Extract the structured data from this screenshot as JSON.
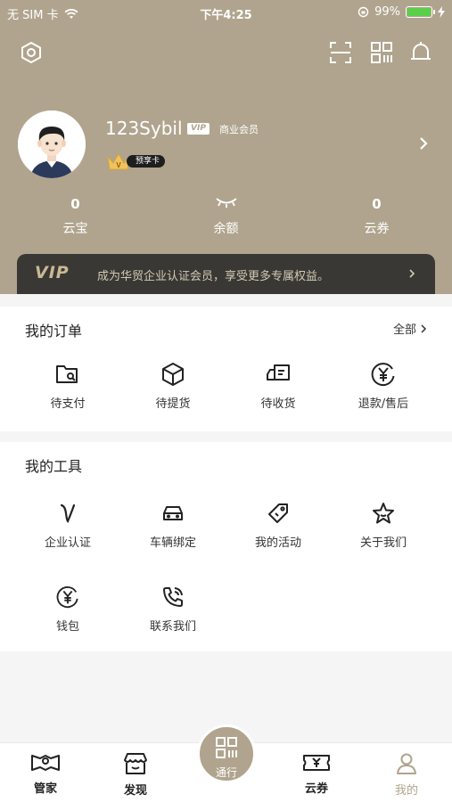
{
  "status_bar": {
    "carrier": "无 SIM 卡",
    "time": "下午4:25",
    "battery": "99%",
    "battery_level": 0.99
  },
  "header": {
    "settings_icon": "settings-hex-icon",
    "scan_icon": "scan-icon",
    "qrcode_icon": "qrcode-icon",
    "bell_icon": "bell-icon"
  },
  "profile": {
    "username": "123Sybil",
    "vip_tag": "VIP",
    "member_type": "商业会员",
    "badge": "预享卡"
  },
  "stats": [
    {
      "value": "0",
      "label": "云宝"
    },
    {
      "value": "",
      "label": "余额"
    },
    {
      "value": "0",
      "label": "云券"
    }
  ],
  "vip_banner": {
    "logo": "VIP",
    "text": "成为华贸企业认证会员，享受更多专属权益。"
  },
  "orders": {
    "title": "我的订单",
    "more": "全部",
    "items": [
      {
        "label": "待支付",
        "icon": "wallet-icon"
      },
      {
        "label": "待提货",
        "icon": "box-icon"
      },
      {
        "label": "待收货",
        "icon": "truck-icon"
      },
      {
        "label": "退款/售后",
        "icon": "yen-circle-icon"
      }
    ]
  },
  "tools": {
    "title": "我的工具",
    "items": [
      {
        "label": "企业认证",
        "icon": "v-icon"
      },
      {
        "label": "车辆绑定",
        "icon": "car-icon"
      },
      {
        "label": "我的活动",
        "icon": "tag-icon"
      },
      {
        "label": "关于我们",
        "icon": "star-icon"
      },
      {
        "label": "钱包",
        "icon": "yen-circle-icon"
      },
      {
        "label": "联系我们",
        "icon": "phone-icon"
      }
    ]
  },
  "tabbar": {
    "items": [
      {
        "label": "管家",
        "icon": "map-icon"
      },
      {
        "label": "发现",
        "icon": "store-icon"
      },
      {
        "label": "通行",
        "icon": "qrcode-icon"
      },
      {
        "label": "云券",
        "icon": "ticket-icon"
      },
      {
        "label": "我的",
        "icon": "user-icon"
      }
    ],
    "active": "我的"
  },
  "colors": {
    "header_bg": "#b0a48e",
    "banner_bg": "#3a3835",
    "accent": "#b0a48e"
  }
}
